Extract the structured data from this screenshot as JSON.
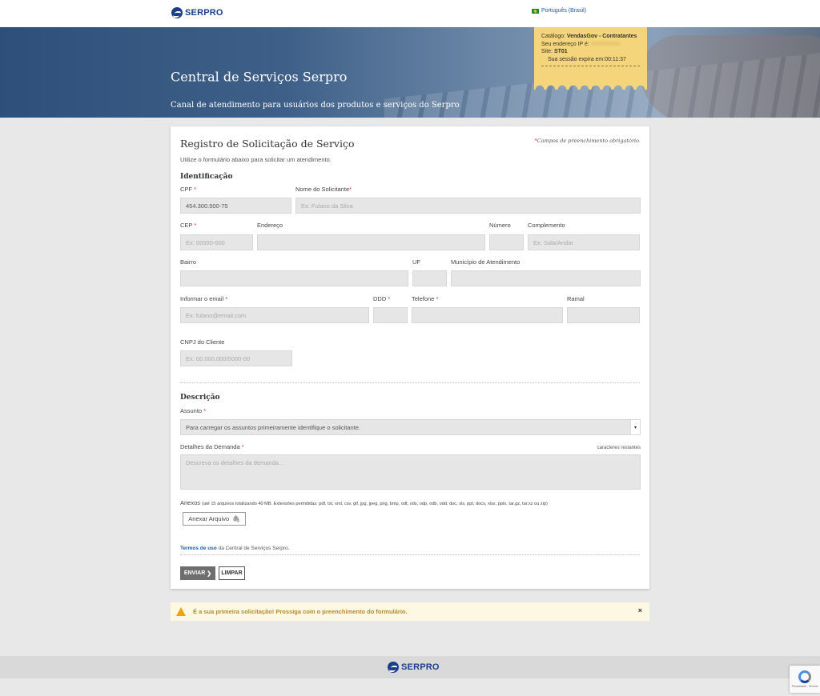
{
  "header": {
    "logo_text": "SERPRO",
    "language": "Português (Brasil)"
  },
  "hero": {
    "title": "Central de Serviços Serpro",
    "subtitle": "Canal de atendimento para usuários dos produtos e serviços do Serpro"
  },
  "ticket": {
    "catalog_label": "Catálogo:",
    "catalog_value": "VendasGov - Contratantes",
    "ip_label": "Seu endereço IP é:",
    "site_label": "Site:",
    "site_value": "ST01",
    "session_label": "Sua sessão expira em:",
    "session_value": "00:11:37"
  },
  "form": {
    "title": "Registro de Solicitação de Serviço",
    "required_note": "Campos de preenchimento obrigatório.",
    "required_mark": "*",
    "intro": "Utilize o formulário abaixo para solicitar um atendimento.",
    "section_identification": "Identificação",
    "section_description": "Descrição",
    "fields": {
      "cpf": {
        "label": "CPF",
        "value": "454.300.500-75"
      },
      "nome": {
        "label": "Nome do Solicitante",
        "placeholder": "Ex: Fulano da Silva"
      },
      "cep": {
        "label": "CEP",
        "placeholder": "Ex: 00000-000"
      },
      "endereco": {
        "label": "Endereço"
      },
      "numero": {
        "label": "Número"
      },
      "complemento": {
        "label": "Complemento",
        "placeholder": "Ex: Sala/Andar"
      },
      "bairro": {
        "label": "Bairro"
      },
      "uf": {
        "label": "UF"
      },
      "municipio": {
        "label": "Município de Atendimento"
      },
      "email": {
        "label": "Informar o email",
        "placeholder": "Ex: fulano@email.com"
      },
      "ddd": {
        "label": "DDD"
      },
      "telefone": {
        "label": "Telefone"
      },
      "ramal": {
        "label": "Ramal"
      },
      "cnpj": {
        "label": "CNPJ do Cliente",
        "placeholder": "Ex: 00.000.000/0000-00"
      },
      "assunto": {
        "label": "Assunto",
        "value": "Para carregar os assuntos primeiramente identifique o solicitante."
      },
      "detalhes": {
        "label": "Detalhes da Demanda",
        "placeholder": "Descreva os detalhes da demanda...",
        "counter": "caracteres restantes"
      }
    },
    "attachments_label": "Anexos",
    "attachments_hint": "(até 15 arquivos totalizando 40 MB. Extensões permitidas: pdf, txt, xml, csv, gif, jpg, jpeg, png, bmp, odt, ods, odp, odb, odd, doc, xls, ppt, docx, xlsx, pptx, tar.gz, tar.xz ou zip)",
    "attach_button": "Anexar Arquivo",
    "terms_link": "Termos de uso",
    "terms_text": "da Central de Serviços Serpro.",
    "send_button": "ENVIAR",
    "clear_button": "LIMPAR"
  },
  "alert": {
    "message": "É a sua primeira solicitação! Prossiga com o preenchimento do formulário.",
    "close": "×"
  },
  "footer": {
    "logo_text": "SERPRO"
  },
  "recaptcha": {
    "text": "Privacidade - Termos"
  }
}
